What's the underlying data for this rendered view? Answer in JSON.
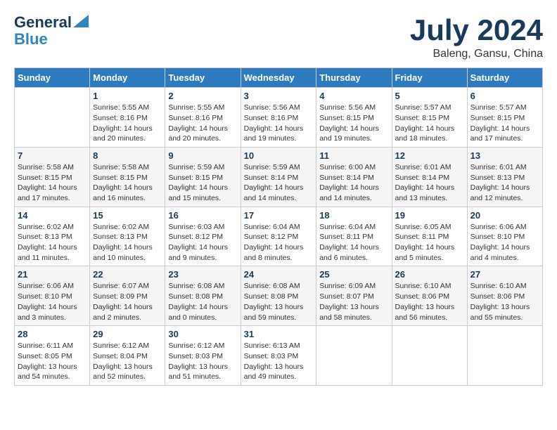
{
  "header": {
    "logo_line1": "General",
    "logo_line2": "Blue",
    "month": "July 2024",
    "location": "Baleng, Gansu, China"
  },
  "weekdays": [
    "Sunday",
    "Monday",
    "Tuesday",
    "Wednesday",
    "Thursday",
    "Friday",
    "Saturday"
  ],
  "weeks": [
    [
      {
        "day": "",
        "info": ""
      },
      {
        "day": "1",
        "info": "Sunrise: 5:55 AM\nSunset: 8:16 PM\nDaylight: 14 hours\nand 20 minutes."
      },
      {
        "day": "2",
        "info": "Sunrise: 5:55 AM\nSunset: 8:16 PM\nDaylight: 14 hours\nand 20 minutes."
      },
      {
        "day": "3",
        "info": "Sunrise: 5:56 AM\nSunset: 8:16 PM\nDaylight: 14 hours\nand 19 minutes."
      },
      {
        "day": "4",
        "info": "Sunrise: 5:56 AM\nSunset: 8:15 PM\nDaylight: 14 hours\nand 19 minutes."
      },
      {
        "day": "5",
        "info": "Sunrise: 5:57 AM\nSunset: 8:15 PM\nDaylight: 14 hours\nand 18 minutes."
      },
      {
        "day": "6",
        "info": "Sunrise: 5:57 AM\nSunset: 8:15 PM\nDaylight: 14 hours\nand 17 minutes."
      }
    ],
    [
      {
        "day": "7",
        "info": "Sunrise: 5:58 AM\nSunset: 8:15 PM\nDaylight: 14 hours\nand 17 minutes."
      },
      {
        "day": "8",
        "info": "Sunrise: 5:58 AM\nSunset: 8:15 PM\nDaylight: 14 hours\nand 16 minutes."
      },
      {
        "day": "9",
        "info": "Sunrise: 5:59 AM\nSunset: 8:15 PM\nDaylight: 14 hours\nand 15 minutes."
      },
      {
        "day": "10",
        "info": "Sunrise: 5:59 AM\nSunset: 8:14 PM\nDaylight: 14 hours\nand 14 minutes."
      },
      {
        "day": "11",
        "info": "Sunrise: 6:00 AM\nSunset: 8:14 PM\nDaylight: 14 hours\nand 14 minutes."
      },
      {
        "day": "12",
        "info": "Sunrise: 6:01 AM\nSunset: 8:14 PM\nDaylight: 14 hours\nand 13 minutes."
      },
      {
        "day": "13",
        "info": "Sunrise: 6:01 AM\nSunset: 8:13 PM\nDaylight: 14 hours\nand 12 minutes."
      }
    ],
    [
      {
        "day": "14",
        "info": "Sunrise: 6:02 AM\nSunset: 8:13 PM\nDaylight: 14 hours\nand 11 minutes."
      },
      {
        "day": "15",
        "info": "Sunrise: 6:02 AM\nSunset: 8:13 PM\nDaylight: 14 hours\nand 10 minutes."
      },
      {
        "day": "16",
        "info": "Sunrise: 6:03 AM\nSunset: 8:12 PM\nDaylight: 14 hours\nand 9 minutes."
      },
      {
        "day": "17",
        "info": "Sunrise: 6:04 AM\nSunset: 8:12 PM\nDaylight: 14 hours\nand 8 minutes."
      },
      {
        "day": "18",
        "info": "Sunrise: 6:04 AM\nSunset: 8:11 PM\nDaylight: 14 hours\nand 6 minutes."
      },
      {
        "day": "19",
        "info": "Sunrise: 6:05 AM\nSunset: 8:11 PM\nDaylight: 14 hours\nand 5 minutes."
      },
      {
        "day": "20",
        "info": "Sunrise: 6:06 AM\nSunset: 8:10 PM\nDaylight: 14 hours\nand 4 minutes."
      }
    ],
    [
      {
        "day": "21",
        "info": "Sunrise: 6:06 AM\nSunset: 8:10 PM\nDaylight: 14 hours\nand 3 minutes."
      },
      {
        "day": "22",
        "info": "Sunrise: 6:07 AM\nSunset: 8:09 PM\nDaylight: 14 hours\nand 2 minutes."
      },
      {
        "day": "23",
        "info": "Sunrise: 6:08 AM\nSunset: 8:08 PM\nDaylight: 14 hours\nand 0 minutes."
      },
      {
        "day": "24",
        "info": "Sunrise: 6:08 AM\nSunset: 8:08 PM\nDaylight: 13 hours\nand 59 minutes."
      },
      {
        "day": "25",
        "info": "Sunrise: 6:09 AM\nSunset: 8:07 PM\nDaylight: 13 hours\nand 58 minutes."
      },
      {
        "day": "26",
        "info": "Sunrise: 6:10 AM\nSunset: 8:06 PM\nDaylight: 13 hours\nand 56 minutes."
      },
      {
        "day": "27",
        "info": "Sunrise: 6:10 AM\nSunset: 8:06 PM\nDaylight: 13 hours\nand 55 minutes."
      }
    ],
    [
      {
        "day": "28",
        "info": "Sunrise: 6:11 AM\nSunset: 8:05 PM\nDaylight: 13 hours\nand 54 minutes."
      },
      {
        "day": "29",
        "info": "Sunrise: 6:12 AM\nSunset: 8:04 PM\nDaylight: 13 hours\nand 52 minutes."
      },
      {
        "day": "30",
        "info": "Sunrise: 6:12 AM\nSunset: 8:03 PM\nDaylight: 13 hours\nand 51 minutes."
      },
      {
        "day": "31",
        "info": "Sunrise: 6:13 AM\nSunset: 8:03 PM\nDaylight: 13 hours\nand 49 minutes."
      },
      {
        "day": "",
        "info": ""
      },
      {
        "day": "",
        "info": ""
      },
      {
        "day": "",
        "info": ""
      }
    ]
  ]
}
